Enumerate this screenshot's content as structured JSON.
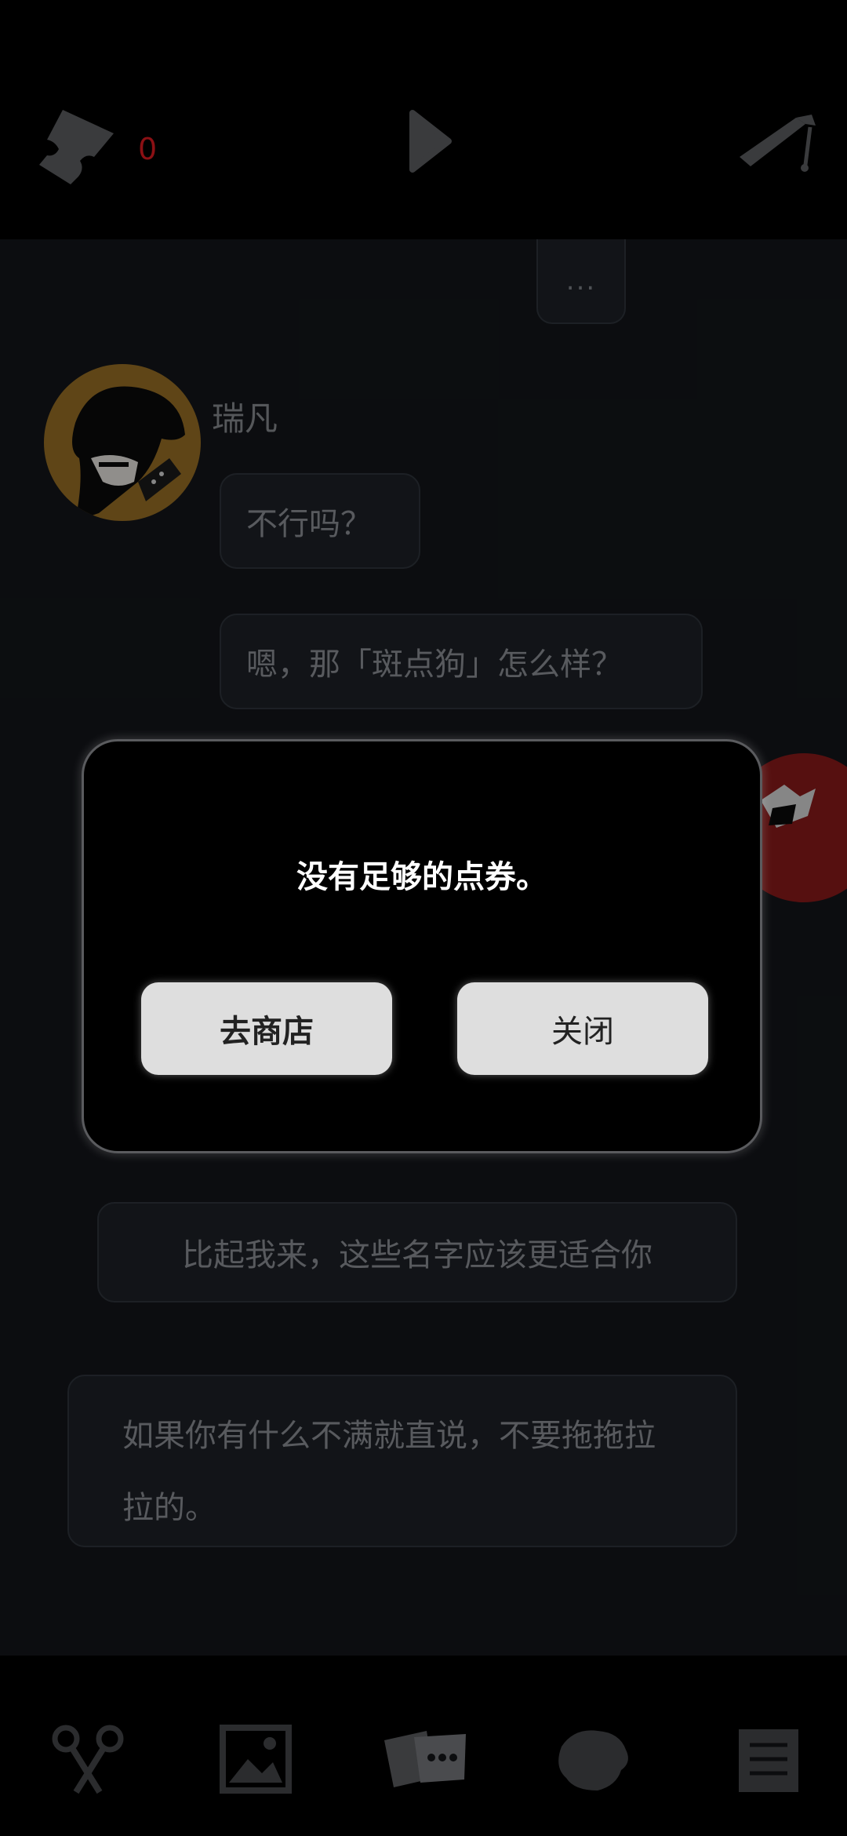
{
  "top": {
    "ticket_count": "0"
  },
  "chat": {
    "typing_indicator": "...",
    "speaker_name": "瑞凡",
    "messages": [
      "不行吗？",
      "嗯，那「斑点狗」怎么样？",
      "比起我来，这些名字应该更适合你",
      "如果你有什么不满就直说，不要拖拖拉拉的。"
    ]
  },
  "modal": {
    "message": "没有足够的点券。",
    "shop_button": "去商店",
    "close_button": "关闭"
  },
  "bottom_tabs": [
    {
      "icon": "scissors-icon"
    },
    {
      "icon": "gallery-icon"
    },
    {
      "icon": "chat-cards-icon"
    },
    {
      "icon": "character-icon"
    },
    {
      "icon": "document-icon"
    }
  ],
  "colors": {
    "background": "#14161a",
    "bubble": "#1d2127",
    "modal": "#000000",
    "button": "#dedede",
    "ticket_count": "#8b1014",
    "avatar_gold": "#9a7026",
    "avatar_red": "#8c1a1a"
  }
}
